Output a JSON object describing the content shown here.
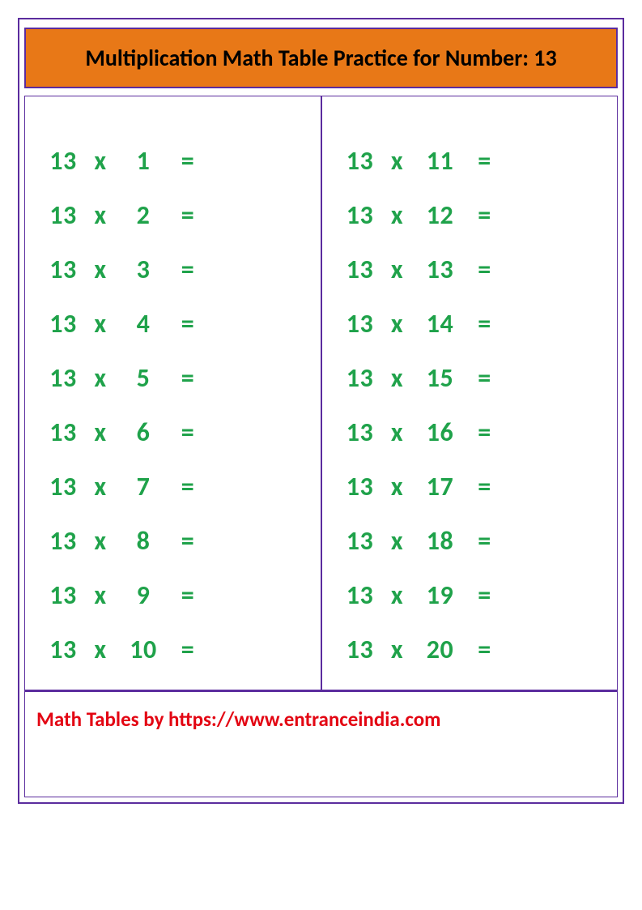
{
  "header": {
    "title": "Multiplication Math Table Practice for Number: 13"
  },
  "left_column": [
    {
      "base": "13",
      "op": "x",
      "mult": "1",
      "eq": "="
    },
    {
      "base": "13",
      "op": "x",
      "mult": "2",
      "eq": "="
    },
    {
      "base": "13",
      "op": "x",
      "mult": "3",
      "eq": "="
    },
    {
      "base": "13",
      "op": "x",
      "mult": "4",
      "eq": "="
    },
    {
      "base": "13",
      "op": "x",
      "mult": "5",
      "eq": "="
    },
    {
      "base": "13",
      "op": "x",
      "mult": "6",
      "eq": "="
    },
    {
      "base": "13",
      "op": "x",
      "mult": "7",
      "eq": "="
    },
    {
      "base": "13",
      "op": "x",
      "mult": "8",
      "eq": "="
    },
    {
      "base": "13",
      "op": "x",
      "mult": "9",
      "eq": "="
    },
    {
      "base": "13",
      "op": "x",
      "mult": "10",
      "eq": "="
    }
  ],
  "right_column": [
    {
      "base": "13",
      "op": "x",
      "mult": "11",
      "eq": "="
    },
    {
      "base": "13",
      "op": "x",
      "mult": "12",
      "eq": "="
    },
    {
      "base": "13",
      "op": "x",
      "mult": "13",
      "eq": "="
    },
    {
      "base": "13",
      "op": "x",
      "mult": "14",
      "eq": "="
    },
    {
      "base": "13",
      "op": "x",
      "mult": "15",
      "eq": "="
    },
    {
      "base": "13",
      "op": "x",
      "mult": "16",
      "eq": "="
    },
    {
      "base": "13",
      "op": "x",
      "mult": "17",
      "eq": "="
    },
    {
      "base": "13",
      "op": "x",
      "mult": "18",
      "eq": "="
    },
    {
      "base": "13",
      "op": "x",
      "mult": "19",
      "eq": "="
    },
    {
      "base": "13",
      "op": "x",
      "mult": "20",
      "eq": "="
    }
  ],
  "footer": {
    "text": "Math Tables by https://www.entranceindia.com"
  }
}
